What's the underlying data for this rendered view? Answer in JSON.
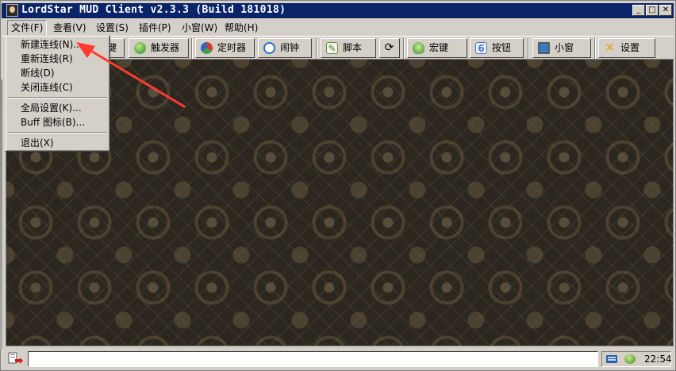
{
  "window": {
    "title": "LordStar MUD Client v2.3.3 (Build 181018)"
  },
  "title_buttons": {
    "minimize": "_",
    "maximize": "□",
    "close": "✕"
  },
  "menubar": {
    "items": [
      {
        "label": "文件(F)",
        "open": true
      },
      {
        "label": "查看(V)"
      },
      {
        "label": "设置(S)"
      },
      {
        "label": "插件(P)"
      },
      {
        "label": "小窗(W)"
      },
      {
        "label": "帮助(H)"
      }
    ]
  },
  "file_menu": {
    "items": [
      {
        "label": "新建连线(N)..."
      },
      {
        "label": "重新连线(R)"
      },
      {
        "label": "断线(D)"
      },
      {
        "label": "关闭连线(C)"
      },
      {
        "label": "全局设置(K)..."
      },
      {
        "label": "Buff 图标(B)..."
      },
      {
        "label": "退出(X)"
      }
    ]
  },
  "toolbar": {
    "buttons": [
      {
        "label": "键",
        "icon": "key-icon"
      },
      {
        "label": "触发器",
        "icon": "trigger-icon",
        "color": "#2f9b2f"
      },
      {
        "label": "定时器",
        "icon": "timer-icon",
        "color": "#c73b2e"
      },
      {
        "label": "闹钟",
        "icon": "alarm-icon",
        "color": "#2c6fc2"
      },
      {
        "label": "脚本",
        "icon": "script-icon",
        "color": "#3a8a3a"
      },
      {
        "label": "",
        "icon": "refresh-icon"
      },
      {
        "label": "宏键",
        "icon": "macro-icon",
        "color": "#3e9a3e"
      },
      {
        "label": "按钮",
        "icon": "button-icon",
        "color": "#4a7cc9"
      },
      {
        "label": "小窗",
        "icon": "monitor-icon",
        "color": "#2f6db5"
      },
      {
        "label": "设置",
        "icon": "settings-tools-icon",
        "color": "#e0a020"
      }
    ]
  },
  "statusbar": {
    "command_value": "",
    "clock": "22:54"
  }
}
